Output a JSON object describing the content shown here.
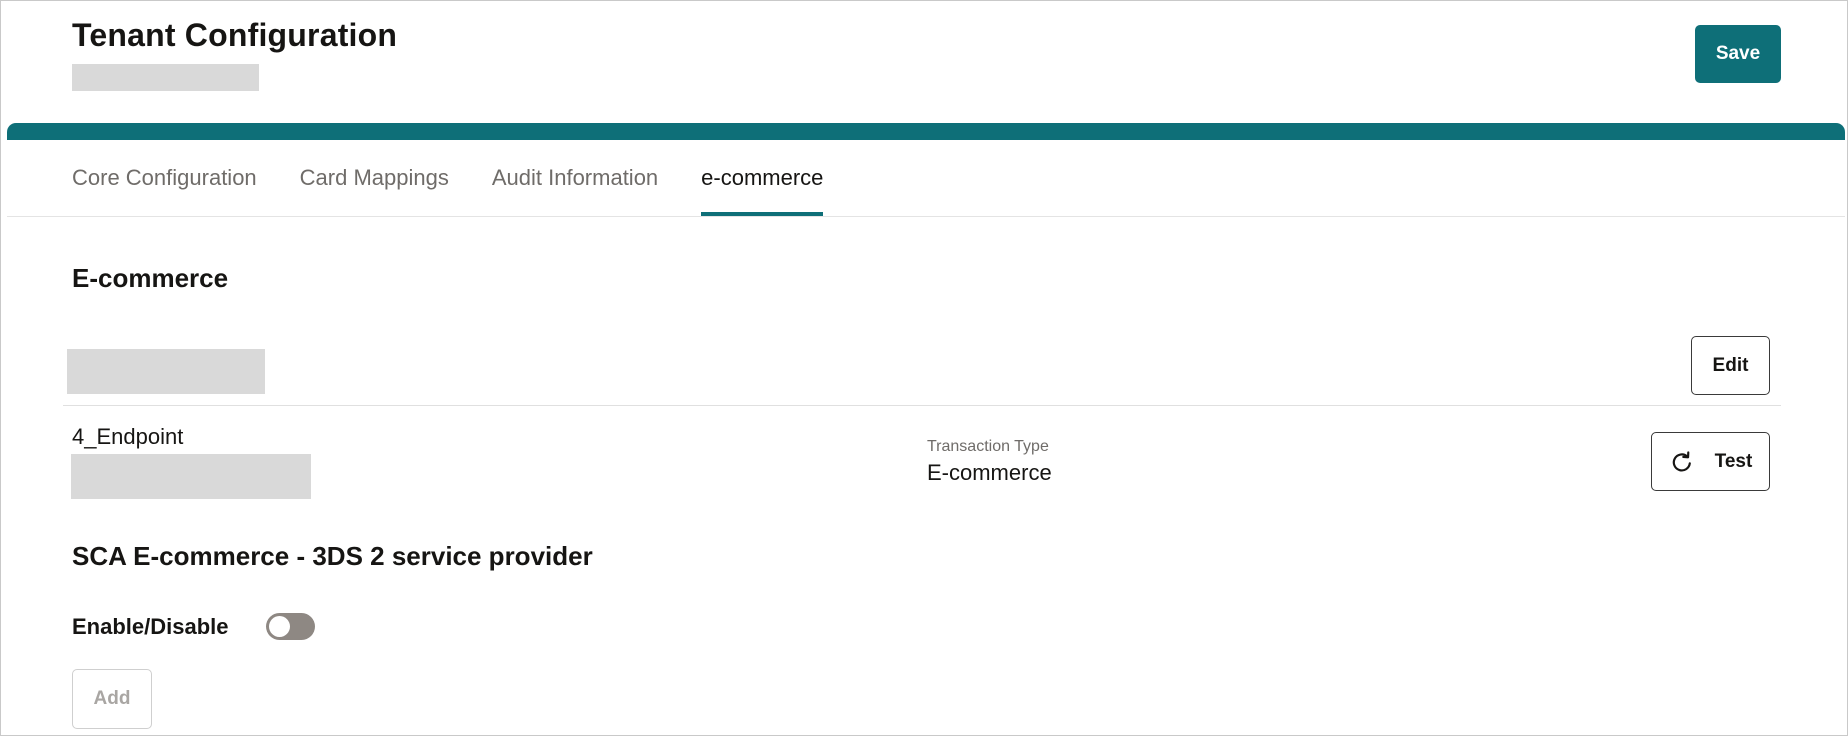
{
  "header": {
    "title": "Tenant Configuration",
    "save_label": "Save"
  },
  "tabs": [
    {
      "label": "Core Configuration",
      "active": false
    },
    {
      "label": "Card Mappings",
      "active": false
    },
    {
      "label": "Audit Information",
      "active": false
    },
    {
      "label": "e-commerce",
      "active": true
    }
  ],
  "ecommerce": {
    "title": "E-commerce",
    "edit_label": "Edit",
    "endpoint": {
      "name": "4_Endpoint",
      "transaction_type_label": "Transaction Type",
      "transaction_type_value": "E-commerce",
      "test_label": "Test",
      "test_icon": "refresh-icon"
    }
  },
  "sca": {
    "title": "SCA E-commerce - 3DS 2 service provider",
    "toggle_label": "Enable/Disable",
    "toggle_enabled": false,
    "add_label": "Add",
    "add_disabled": true
  },
  "colors": {
    "accent": "#0e6f78",
    "toggle_off": "#8e8883",
    "redacted": "#d9d9d9"
  }
}
